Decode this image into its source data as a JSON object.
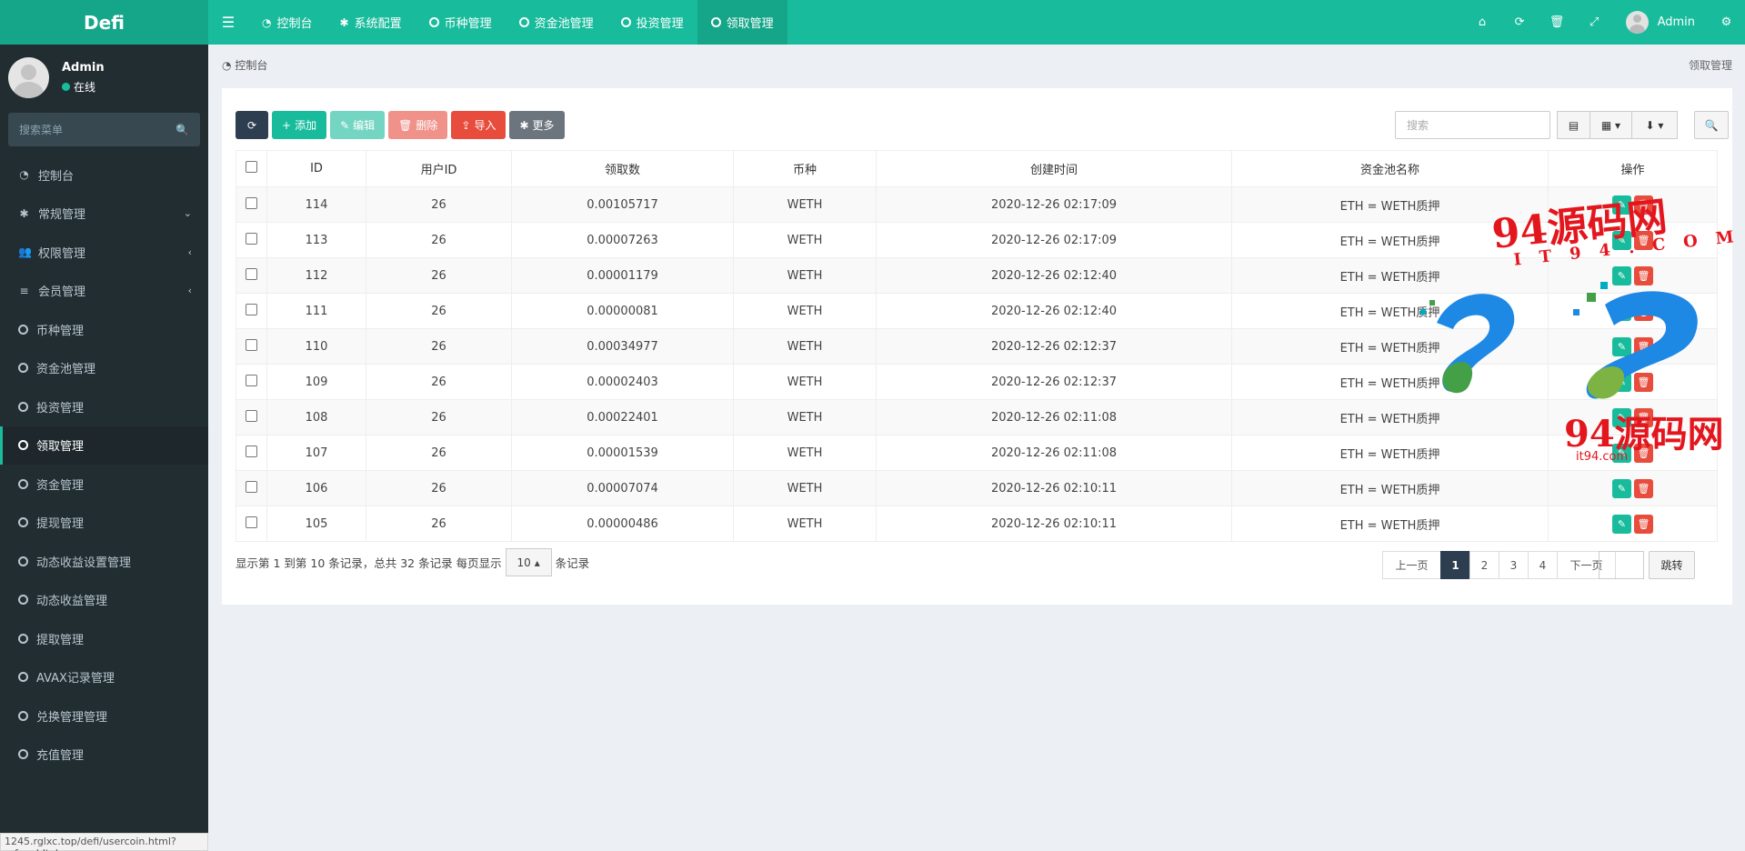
{
  "app": {
    "logo": "Defi"
  },
  "topnav": {
    "tabs": [
      {
        "label": "控制台",
        "icon": "dashboard-icon"
      },
      {
        "label": "系统配置",
        "icon": "cog-icon"
      },
      {
        "label": "币种管理",
        "icon": "circle-icon"
      },
      {
        "label": "资金池管理",
        "icon": "circle-icon"
      },
      {
        "label": "投资管理",
        "icon": "circle-icon"
      },
      {
        "label": "领取管理",
        "icon": "circle-icon",
        "active": true
      }
    ],
    "user": "Admin"
  },
  "sidebar": {
    "user": {
      "name": "Admin",
      "status": "在线"
    },
    "search_placeholder": "搜索菜单",
    "items": [
      {
        "label": "控制台",
        "icon": "dashboard-icon"
      },
      {
        "label": "常规管理",
        "icon": "cogs-icon",
        "arrow": "down"
      },
      {
        "label": "权限管理",
        "icon": "users-icon",
        "arrow": "left"
      },
      {
        "label": "会员管理",
        "icon": "list-icon",
        "arrow": "left"
      },
      {
        "label": "币种管理",
        "icon": "circle-icon"
      },
      {
        "label": "资金池管理",
        "icon": "circle-icon"
      },
      {
        "label": "投资管理",
        "icon": "circle-icon"
      },
      {
        "label": "领取管理",
        "icon": "circle-icon",
        "active": true
      },
      {
        "label": "资金管理",
        "icon": "circle-icon"
      },
      {
        "label": "提现管理",
        "icon": "circle-icon"
      },
      {
        "label": "动态收益设置管理",
        "icon": "circle-icon"
      },
      {
        "label": "动态收益管理",
        "icon": "circle-icon"
      },
      {
        "label": "提取管理",
        "icon": "circle-icon"
      },
      {
        "label": "AVAX记录管理",
        "icon": "circle-icon"
      },
      {
        "label": "兑换管理管理",
        "icon": "circle-icon"
      },
      {
        "label": "充值管理",
        "icon": "circle-icon"
      }
    ]
  },
  "status_url": "1245.rglxc.top/defi/usercoin.html?ref=addtabs",
  "breadcrumb": {
    "label": "控制台",
    "right": "领取管理"
  },
  "toolbar": {
    "add": "添加",
    "edit": "编辑",
    "delete": "删除",
    "import": "导入",
    "more": "更多",
    "search_placeholder": "搜索"
  },
  "table": {
    "columns": [
      "ID",
      "用户ID",
      "领取数",
      "币种",
      "创建时间",
      "资金池名称",
      "操作"
    ],
    "rows": [
      [
        "114",
        "26",
        "0.00105717",
        "WETH",
        "2020-12-26 02:17:09",
        "ETH = WETH质押"
      ],
      [
        "113",
        "26",
        "0.00007263",
        "WETH",
        "2020-12-26 02:17:09",
        "ETH = WETH质押"
      ],
      [
        "112",
        "26",
        "0.00001179",
        "WETH",
        "2020-12-26 02:12:40",
        "ETH = WETH质押"
      ],
      [
        "111",
        "26",
        "0.00000081",
        "WETH",
        "2020-12-26 02:12:40",
        "ETH = WETH质押"
      ],
      [
        "110",
        "26",
        "0.00034977",
        "WETH",
        "2020-12-26 02:12:37",
        "ETH = WETH质押"
      ],
      [
        "109",
        "26",
        "0.00002403",
        "WETH",
        "2020-12-26 02:12:37",
        "ETH = WETH质押"
      ],
      [
        "108",
        "26",
        "0.00022401",
        "WETH",
        "2020-12-26 02:11:08",
        "ETH = WETH质押"
      ],
      [
        "107",
        "26",
        "0.00001539",
        "WETH",
        "2020-12-26 02:11:08",
        "ETH = WETH质押"
      ],
      [
        "106",
        "26",
        "0.00007074",
        "WETH",
        "2020-12-26 02:10:11",
        "ETH = WETH质押"
      ],
      [
        "105",
        "26",
        "0.00000486",
        "WETH",
        "2020-12-26 02:10:11",
        "ETH = WETH质押"
      ]
    ]
  },
  "pagination": {
    "info_prefix": "显示第 1 到第 10 条记录，总共 32 条记录 每页显示",
    "page_size": "10",
    "info_suffix": "条记录",
    "prev": "上一页",
    "pages": [
      "1",
      "2",
      "3",
      "4"
    ],
    "current": "1",
    "next": "下一页",
    "jump": "跳转"
  },
  "watermark": {
    "line1": "94源码网",
    "line2": "IT94.COM",
    "line3": "94源码网",
    "line4": "it94.com"
  },
  "colors": {
    "primary": "#18bc9c",
    "sidebar": "#222d32",
    "danger": "#e74c3c",
    "dark": "#2c3e50"
  }
}
